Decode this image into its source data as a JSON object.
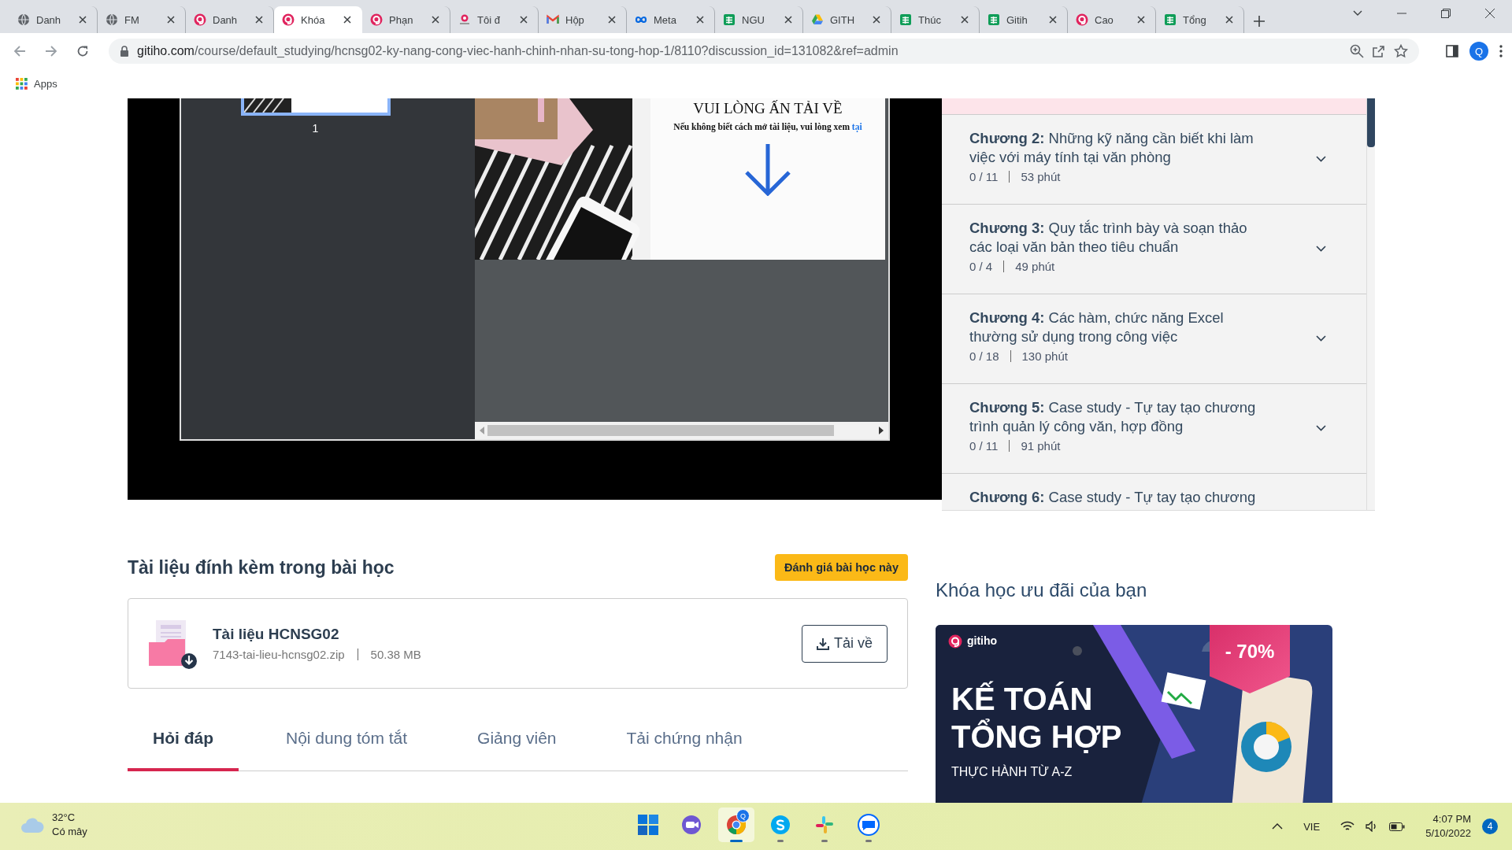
{
  "browser": {
    "tabs": [
      {
        "title": "Danh",
        "kind": "globe",
        "selected": false
      },
      {
        "title": "FM",
        "kind": "globe",
        "selected": false
      },
      {
        "title": "Danh",
        "kind": "gitiho",
        "selected": false
      },
      {
        "title": "Khóa",
        "kind": "gitiho",
        "selected": true
      },
      {
        "title": "Phạn",
        "kind": "gitiho",
        "selected": false
      },
      {
        "title": "Tôi đ",
        "kind": "wordmark",
        "selected": false
      },
      {
        "title": "Hộp",
        "kind": "gmail",
        "selected": false
      },
      {
        "title": "Meta",
        "kind": "meta",
        "selected": false
      },
      {
        "title": "NGU",
        "kind": "sheets",
        "selected": false
      },
      {
        "title": "GITH",
        "kind": "drive",
        "selected": false
      },
      {
        "title": "Thúc",
        "kind": "sheets",
        "selected": false
      },
      {
        "title": "Gitih",
        "kind": "sheets",
        "selected": false
      },
      {
        "title": "Cao",
        "kind": "gitiho",
        "selected": false
      },
      {
        "title": "Tổng",
        "kind": "sheets",
        "selected": false
      }
    ],
    "url_host": "gitiho.com",
    "url_path": "/course/default_studying/hcnsg02-ky-nang-cong-viec-hanh-chinh-nhan-su-tong-hop-1/8110?discussion_id=131082&ref=admin",
    "profile_initial": "Q",
    "bookmarks": [
      "Apps"
    ]
  },
  "viewer": {
    "page_number": "1",
    "slide_heading": "VUI LÒNG ẤN TẢI VỀ",
    "slide_note": "Nếu không biết cách mở tài liệu, vui lòng xem ",
    "slide_link": "tại"
  },
  "chapters": [
    {
      "label": "Chương 2:",
      "title": "Những kỹ năng cần biết khi làm việc với máy tính tại văn phòng",
      "progress": "0 / 11",
      "duration": "53 phút"
    },
    {
      "label": "Chương 3:",
      "title": "Quy tắc trình bày và soạn thảo các loại văn bản theo tiêu chuẩn",
      "progress": "0 / 4",
      "duration": "49 phút"
    },
    {
      "label": "Chương 4:",
      "title": "Các hàm, chức năng Excel thường sử dụng trong công việc",
      "progress": "0 / 18",
      "duration": "130 phút"
    },
    {
      "label": "Chương 5:",
      "title": "Case study - Tự tay tạo chương trình quản lý công văn, hợp đồng",
      "progress": "0 / 11",
      "duration": "91 phút"
    },
    {
      "label": "Chương 6:",
      "title": "Case study - Tự tay tạo chương"
    }
  ],
  "attachments": {
    "title": "Tài liệu đính kèm trong bài học",
    "rate_button": "Đánh giá bài học này",
    "files": [
      {
        "name": "Tài liệu HCNSG02",
        "filename": "7143-tai-lieu-hcnsg02.zip",
        "size": "50.38 MB",
        "download": "Tải về"
      }
    ]
  },
  "tabs": [
    {
      "label": "Hỏi đáp",
      "selected": true
    },
    {
      "label": "Nội dung tóm tắt",
      "selected": false
    },
    {
      "label": "Giảng viên",
      "selected": false
    },
    {
      "label": "Tải chứng nhận",
      "selected": false
    }
  ],
  "promo": {
    "title": "Khóa học ưu đãi của bạn",
    "brand": "gitiho",
    "course_lines": [
      "KẾ TOÁN",
      "TỔNG HỢP"
    ],
    "subtitle": "THỰC HÀNH TỪ A-Z",
    "discount": "- 70%"
  },
  "taskbar": {
    "temperature": "32°C",
    "condition": "Có mây",
    "apps": [
      {
        "kind": "start",
        "running": false,
        "selected": false
      },
      {
        "kind": "video",
        "running": false,
        "selected": false
      },
      {
        "kind": "chrome",
        "running": true,
        "selected": true,
        "badge": "Q"
      },
      {
        "kind": "skype",
        "running": true,
        "selected": false
      },
      {
        "kind": "slack",
        "running": true,
        "selected": false
      },
      {
        "kind": "zalo",
        "running": true,
        "selected": false
      }
    ],
    "language": "VIE",
    "time": "4:07 PM",
    "date": "5/10/2022",
    "notifications": "4"
  }
}
